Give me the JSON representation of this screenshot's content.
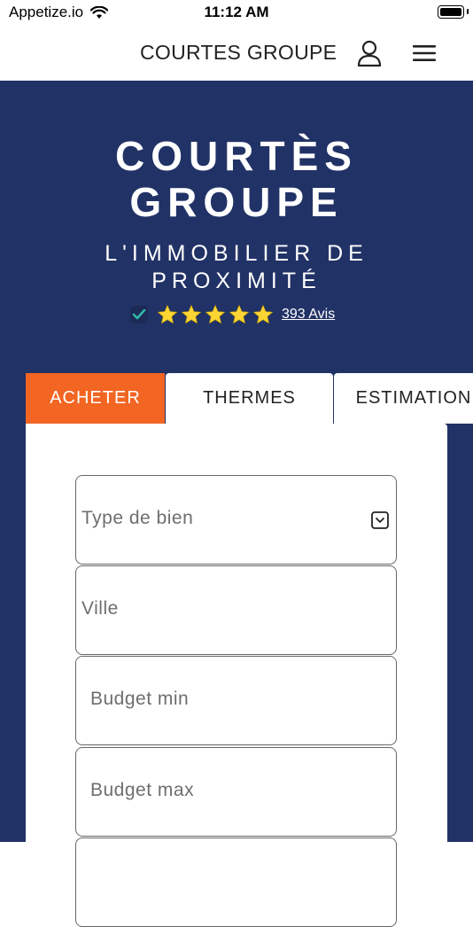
{
  "status_bar": {
    "carrier": "Appetize.io",
    "time": "11:12 AM"
  },
  "navbar": {
    "title": "COURTES GROUPE"
  },
  "hero": {
    "title_line1": "COURTÈS",
    "title_line2": "GROUPE",
    "subtitle_line1": "L'IMMOBILIER DE",
    "subtitle_line2": "PROXIMITÉ",
    "rating": {
      "stars": 5,
      "reviews_link": "393 Avis"
    }
  },
  "tabs": [
    {
      "label": "ACHETER",
      "active": true
    },
    {
      "label": "THERMES",
      "active": false
    },
    {
      "label": "ESTIMATION",
      "active": false
    }
  ],
  "form": {
    "property_type_placeholder": "Type de bien",
    "city_placeholder": "Ville",
    "budget_min_placeholder": "Budget min",
    "budget_max_placeholder": "Budget max"
  },
  "colors": {
    "navy": "#213266",
    "accent": "#f26522",
    "star": "#fcd535"
  }
}
